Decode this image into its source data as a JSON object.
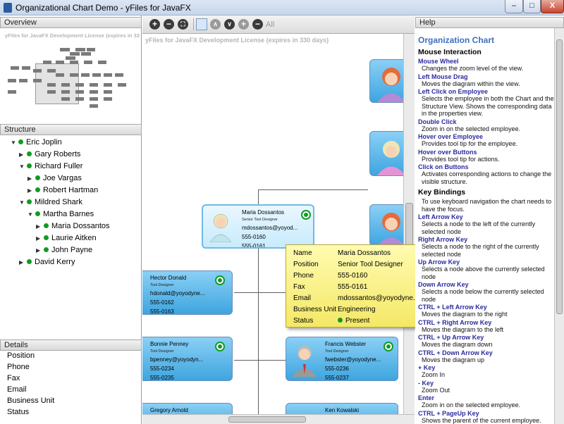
{
  "window": {
    "title": "Organizational Chart Demo - yFiles for JavaFX",
    "minimize": "–",
    "maximize": "□",
    "close": "X"
  },
  "panels": {
    "overview": "Overview",
    "structure": "Structure",
    "details": "Details",
    "help": "Help"
  },
  "watermark": "yFiles for JavaFX Development License (expires in 330 days)",
  "toolbar": {
    "zoom_in": "+",
    "zoom_out": "−",
    "fit": "⛶",
    "up": "∧",
    "down": "∨",
    "add": "+",
    "remove": "−",
    "all": "All"
  },
  "tree": [
    {
      "label": "Eric Joplin",
      "expanded": true,
      "level": 0
    },
    {
      "label": "Gary Roberts",
      "expanded": false,
      "level": 1
    },
    {
      "label": "Richard Fuller",
      "expanded": true,
      "level": 1
    },
    {
      "label": "Joe Vargas",
      "expanded": false,
      "level": 2
    },
    {
      "label": "Robert Hartman",
      "expanded": false,
      "level": 2
    },
    {
      "label": "Mildred Shark",
      "expanded": true,
      "level": 1
    },
    {
      "label": "Martha Barnes",
      "expanded": true,
      "level": 2
    },
    {
      "label": "Maria Dossantos",
      "expanded": false,
      "level": 3
    },
    {
      "label": "Laurie Aitken",
      "expanded": false,
      "level": 3
    },
    {
      "label": "John Payne",
      "expanded": false,
      "level": 3
    },
    {
      "label": "David Kerry",
      "expanded": false,
      "level": 1
    }
  ],
  "details": [
    "Position",
    "Phone",
    "Fax",
    "Email",
    "Business Unit",
    "Status"
  ],
  "nodes": {
    "maria": {
      "name": "Maria Dossantos",
      "position": "Senior Tool Designer",
      "email": "mdossantos@yoyod...",
      "phone": "555-0160",
      "fax": "555-0161"
    },
    "hector": {
      "name": "Hector Donald",
      "position": "Tool Designer",
      "email": "hdonald@yoyodyne...",
      "phone": "555-0162",
      "fax": "555-0163"
    },
    "bonnie": {
      "name": "Bonnie Penney",
      "position": "Tool Designer",
      "email": "bpenney@yoyodyn...",
      "phone": "555-0234",
      "fax": "555-0235"
    },
    "francis": {
      "name": "Francis Webster",
      "position": "Tool Designer",
      "email": "fwebster@yoyodyne...",
      "phone": "555-0236",
      "fax": "555-0237"
    },
    "gregory": {
      "name": "Gregory Arnold"
    },
    "ken": {
      "name": "Ken Kowalski"
    }
  },
  "tooltip": {
    "rows": [
      {
        "label": "Name",
        "value": "Maria Dossantos"
      },
      {
        "label": "Position",
        "value": "Senior Tool Designer"
      },
      {
        "label": "Phone",
        "value": "555-0160"
      },
      {
        "label": "Fax",
        "value": "555-0161"
      },
      {
        "label": "Email",
        "value": "mdossantos@yoyodyne.com"
      },
      {
        "label": "Business Unit",
        "value": "Engineering"
      },
      {
        "label": "Status",
        "value": "Present"
      }
    ]
  },
  "help": {
    "title": "Organization Chart",
    "mouse_heading": "Mouse Interaction",
    "mouse": [
      {
        "key": "Mouse Wheel",
        "desc": "Changes the zoom level of the view."
      },
      {
        "key": "Left Mouse Drag",
        "desc": "Moves the diagram within the view."
      },
      {
        "key": "Left Click on Employee",
        "desc": "Selects the employee in both the Chart and the Structure View. Shows the corresponding data in the properties view."
      },
      {
        "key": "Double Click",
        "desc": "Zoom in on the selected employee."
      },
      {
        "key": "Hover over Employee",
        "desc": "Provides tool tip for the employee."
      },
      {
        "key": "Hover over Buttons",
        "desc": "Provides tool tip for actions."
      },
      {
        "key": "Click on Buttons",
        "desc": "Activates corresponding actions to change the visible structure."
      }
    ],
    "keys_heading": "Key Bindings",
    "keys_intro": "To use keyboard navigation the chart needs to have the focus.",
    "keys": [
      {
        "key": "Left Arrow Key",
        "desc": "Selects a node to the left of the currently selected node"
      },
      {
        "key": "Right Arrow Key",
        "desc": "Selects a node to the right of the currently selected node"
      },
      {
        "key": "Up Arrow Key",
        "desc": "Selects a node above the currently selected node"
      },
      {
        "key": "Down Arrow Key",
        "desc": "Selects a node below the currently selected node"
      },
      {
        "key": "CTRL + Left Arrow Key",
        "desc": "Moves the diagram to the right"
      },
      {
        "key": "CTRL + Right Arrow Key",
        "desc": "Moves the diagram to the left"
      },
      {
        "key": "CTRL + Up Arrow Key",
        "desc": "Moves the diagram down"
      },
      {
        "key": "CTRL + Down Arrow Key",
        "desc": "Moves the diagram up"
      },
      {
        "key": "+ Key",
        "desc": "Zoom In"
      },
      {
        "key": "- Key",
        "desc": "Zoom Out"
      },
      {
        "key": "Enter",
        "desc": "Zoom in on the selected employee."
      },
      {
        "key": "CTRL + PageUp Key",
        "desc": "Shows the parent of the current employee."
      }
    ]
  },
  "colors": {
    "present": "#109b24",
    "node_blue": "#3ea5df",
    "help_title": "#3d6fc0",
    "tooltip_bg": "#f4e867"
  }
}
